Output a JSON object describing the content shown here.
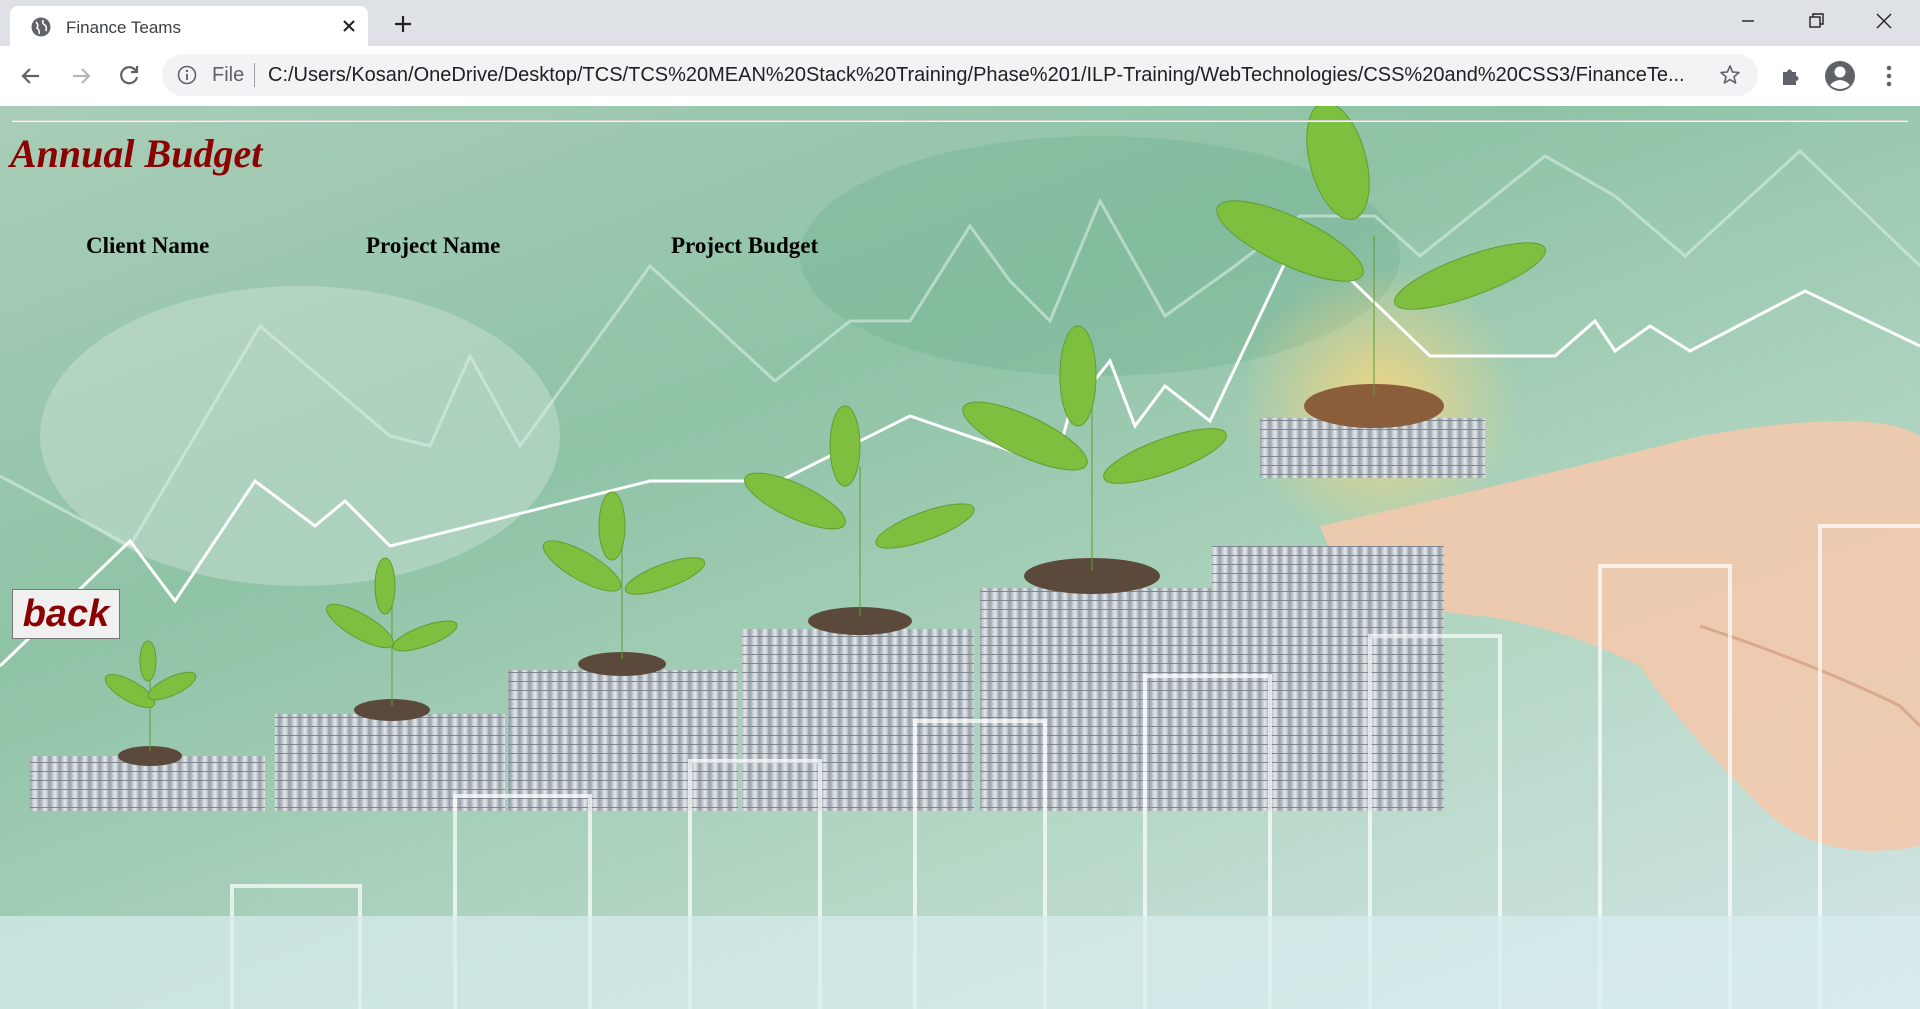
{
  "browser": {
    "tab_title": "Finance Teams",
    "scheme_label": "File",
    "url": "C:/Users/Kosan/OneDrive/Desktop/TCS/TCS%20MEAN%20Stack%20Training/Phase%201/ILP-Training/WebTechnologies/CSS%20and%20CSS3/FinanceTe..."
  },
  "page": {
    "heading": "Annual Budget",
    "table_headers": [
      "Client Name",
      "Project Name",
      "Project Budget"
    ],
    "back_label": "back"
  },
  "colors": {
    "heading": "#8b0000",
    "back_text": "#8b0000"
  },
  "icons": {
    "tab": "globe-icon",
    "tab_close": "close-icon",
    "new_tab": "plus-icon",
    "nav": [
      "back-arrow-icon",
      "forward-arrow-icon",
      "reload-icon"
    ],
    "omnibox": [
      "info-icon",
      "star-icon"
    ],
    "right_toolbar": [
      "extensions-icon",
      "profile-icon",
      "menu-icon"
    ],
    "window": [
      "minimize-icon",
      "restore-icon",
      "window-close-icon"
    ]
  }
}
